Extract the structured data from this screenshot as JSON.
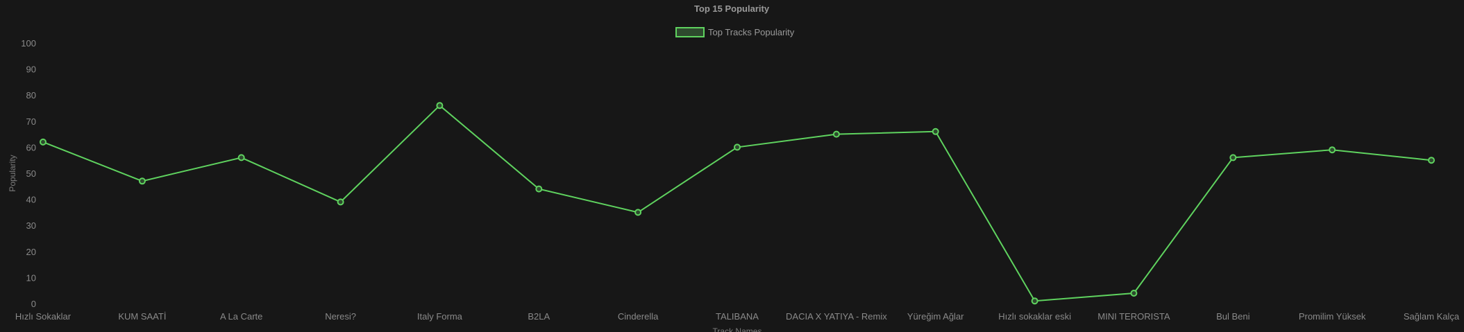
{
  "chart_data": {
    "type": "line",
    "title": "Top 15 Popularity",
    "xlabel": "Track Names",
    "ylabel": "Popularity",
    "ylim": [
      0,
      100
    ],
    "yticks": [
      "0",
      "10",
      "20",
      "30",
      "40",
      "50",
      "60",
      "70",
      "80",
      "90",
      "100"
    ],
    "legend_position": "top",
    "grid": false,
    "categories": [
      "Hızlı Sokaklar",
      "KUM SAATİ",
      "A La Carte",
      "Neresi?",
      "Italy Forma",
      "B2LA",
      "Cinderella",
      "TALIBANA",
      "DACIA X YATIYA - Remix",
      "Yüreğim Ağlar",
      "Hızlı sokaklar eski",
      "MINI TERORISTA",
      "Bul Beni",
      "Promilim Yüksek",
      "Sağlam Kalça"
    ],
    "series": [
      {
        "name": "Top Tracks Popularity",
        "values": [
          62,
          47,
          56,
          39,
          76,
          44,
          35,
          60,
          65,
          66,
          1,
          4,
          56,
          59,
          55
        ],
        "color": "#5fd35f",
        "fill": "#2e4a2e"
      }
    ]
  }
}
